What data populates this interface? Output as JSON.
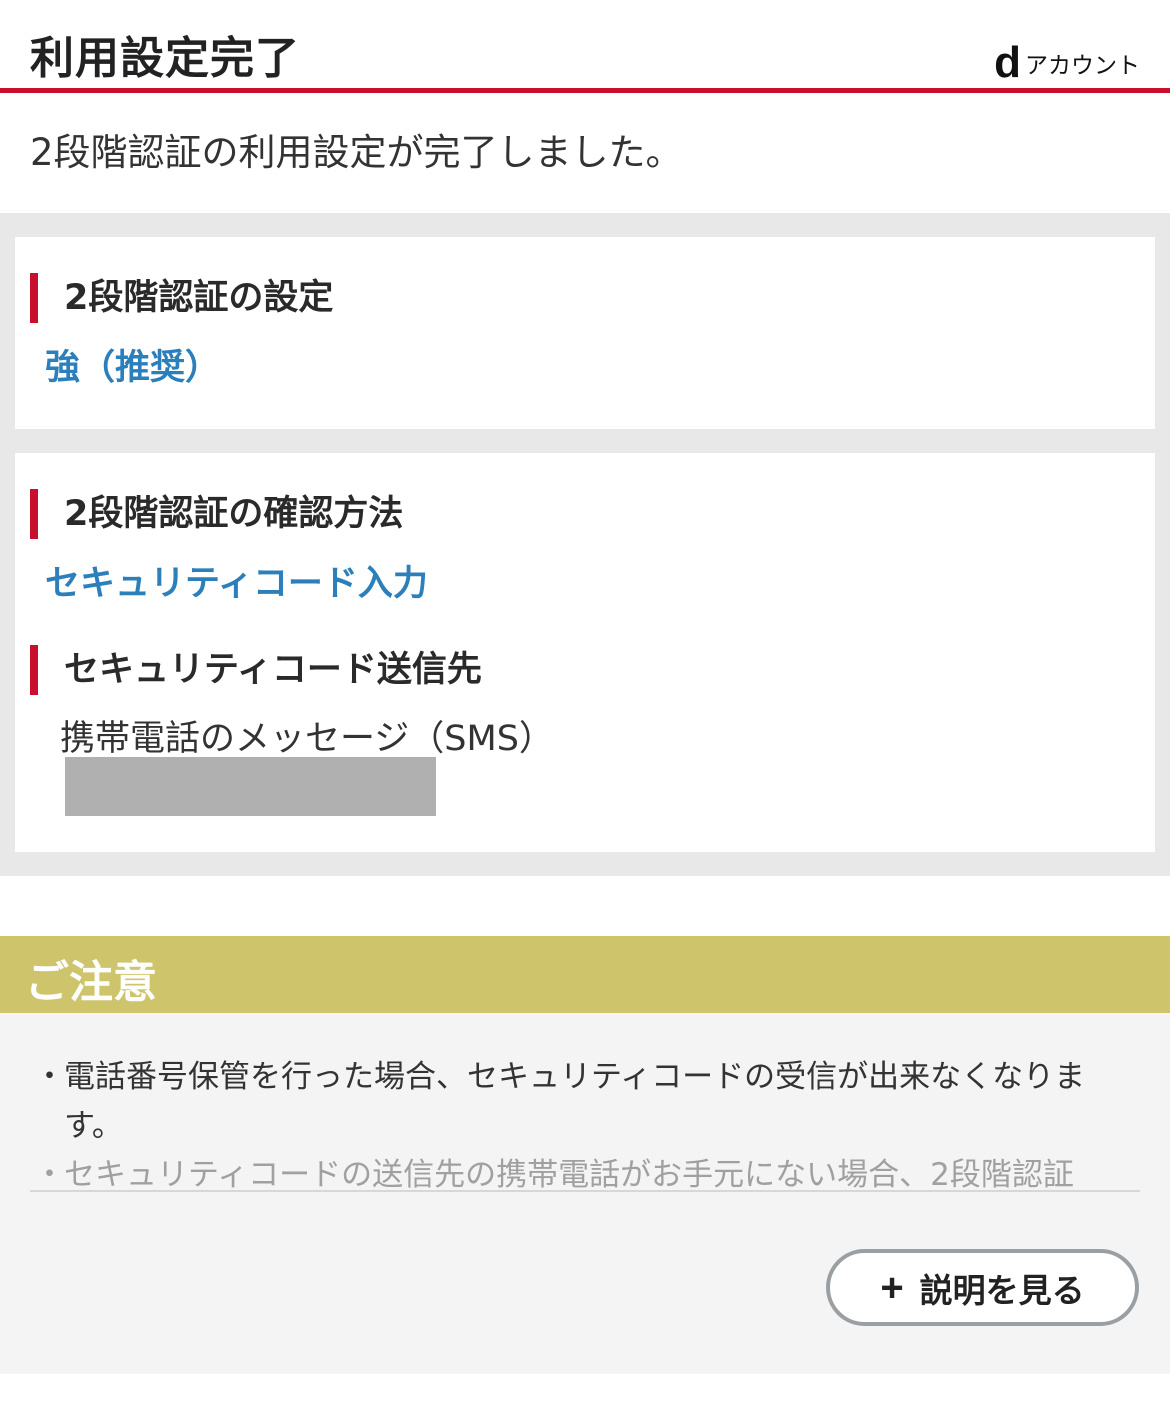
{
  "header": {
    "title": "利用設定完了",
    "brand_logo_letter": "d",
    "brand_label": "アカウント"
  },
  "message": "2段階認証の利用設定が完了しました。",
  "settings_card": {
    "heading": "2段階認証の設定",
    "value": "強（推奨）"
  },
  "method_card": {
    "heading": "2段階認証の確認方法",
    "value": "セキュリティコード入力",
    "destination_heading": "セキュリティコード送信先",
    "destination_value": "携帯電話のメッセージ（SMS）"
  },
  "caution": {
    "title": "ご注意",
    "bullet": "・",
    "notes": [
      "電話番号保管を行った場合、セキュリティコードの受信が出来なくなります。",
      "セキュリティコードの送信先の携帯電話がお手元にない場合、2段階認証"
    ],
    "more_button_label": "説明を見る",
    "more_button_icon": "plus-icon"
  },
  "colors": {
    "accent_red": "#c8102e",
    "link_blue": "#2b7fba",
    "caution_olive": "#cdc46b"
  }
}
